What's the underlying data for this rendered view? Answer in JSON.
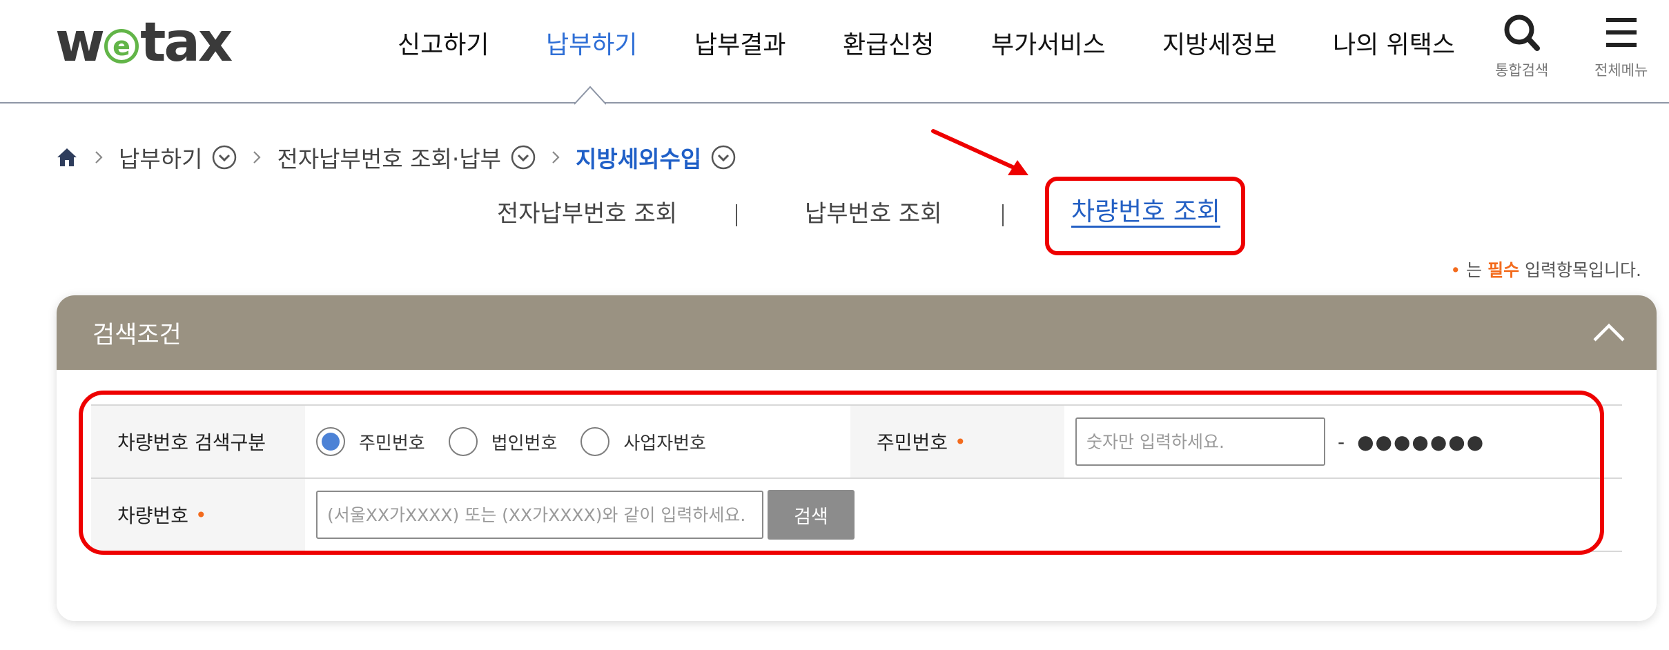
{
  "header": {
    "logo_pre": "w",
    "logo_mid": "e",
    "logo_post": "tax",
    "nav": [
      {
        "label": "신고하기",
        "active": false
      },
      {
        "label": "납부하기",
        "active": true
      },
      {
        "label": "납부결과",
        "active": false
      },
      {
        "label": "환급신청",
        "active": false
      },
      {
        "label": "부가서비스",
        "active": false
      },
      {
        "label": "지방세정보",
        "active": false
      },
      {
        "label": "나의 위택스",
        "active": false
      }
    ],
    "search_label": "통합검색",
    "menu_label": "전체메뉴"
  },
  "breadcrumb": {
    "level1": "납부하기",
    "level2": "전자납부번호 조회·납부",
    "current": "지방세외수입"
  },
  "subtabs": [
    {
      "label": "전자납부번호 조회",
      "active": false
    },
    {
      "label": "납부번호 조회",
      "active": false
    },
    {
      "label": "차량번호 조회",
      "active": true
    }
  ],
  "required_note": {
    "dot": "•",
    "pre": "는",
    "emphasis": "필수",
    "post": "입력항목입니다."
  },
  "panel": {
    "title": "검색조건",
    "row1": {
      "label": "차량번호 검색구분",
      "options": [
        {
          "label": "주민번호",
          "checked": true
        },
        {
          "label": "법인번호",
          "checked": false
        },
        {
          "label": "사업자번호",
          "checked": false
        }
      ],
      "id_label": "주민번호",
      "id_required": "•",
      "id_placeholder": "숫자만 입력하세요.",
      "dash": "-",
      "masked_value": "●●●●●●●"
    },
    "row2": {
      "label": "차량번호",
      "required": "•",
      "placeholder": "(서울XX가XXXX) 또는 (XX가XXXX)와 같이 입력하세요.",
      "search_button": "검색"
    }
  },
  "colors": {
    "accent": "#2f6fd6",
    "panel_header": "#9a9282",
    "required": "#f36b1d",
    "annotation": "#ee0000"
  }
}
